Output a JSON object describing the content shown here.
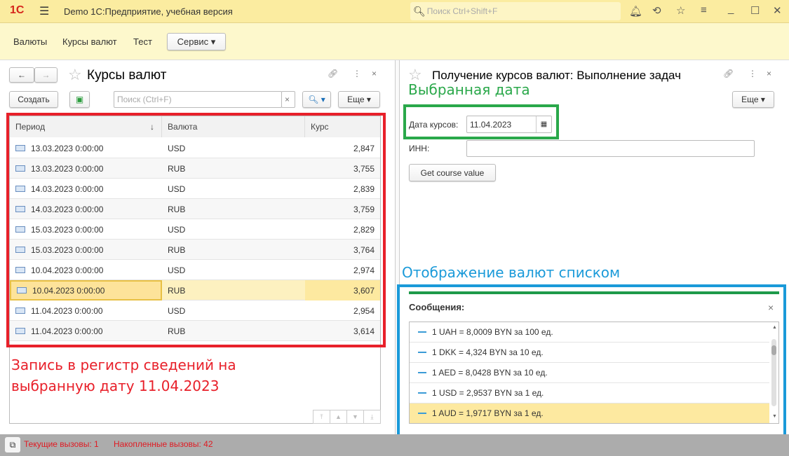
{
  "app": {
    "logo": "1С",
    "title": "Demo 1С:Предприятие, учебная версия",
    "search_placeholder": "Поиск Ctrl+Shift+F"
  },
  "sections": [
    {
      "label": "Валюты"
    },
    {
      "label": "Курсы валют"
    },
    {
      "label": "Тест"
    }
  ],
  "service_label": "Сервис",
  "left": {
    "title": "Курсы валют",
    "create": "Создать",
    "search_placeholder": "Поиск (Ctrl+F)",
    "more": "Еще",
    "columns": [
      "Период",
      "Валюта",
      "Курс"
    ],
    "rows": [
      {
        "period": "13.03.2023 0:00:00",
        "currency": "USD",
        "rate": "2,847"
      },
      {
        "period": "13.03.2023 0:00:00",
        "currency": "RUB",
        "rate": "3,755"
      },
      {
        "period": "14.03.2023 0:00:00",
        "currency": "USD",
        "rate": "2,839"
      },
      {
        "period": "14.03.2023 0:00:00",
        "currency": "RUB",
        "rate": "3,759"
      },
      {
        "period": "15.03.2023 0:00:00",
        "currency": "USD",
        "rate": "2,829"
      },
      {
        "period": "15.03.2023 0:00:00",
        "currency": "RUB",
        "rate": "3,764"
      },
      {
        "period": "10.04.2023 0:00:00",
        "currency": "USD",
        "rate": "2,974"
      },
      {
        "period": "10.04.2023 0:00:00",
        "currency": "RUB",
        "rate": "3,607"
      },
      {
        "period": "11.04.2023 0:00:00",
        "currency": "USD",
        "rate": "2,954"
      },
      {
        "period": "11.04.2023 0:00:00",
        "currency": "RUB",
        "rate": "3,614"
      }
    ],
    "annotation": [
      "Запись в регистр сведений на",
      "выбранную дату 11.04.2023"
    ]
  },
  "right": {
    "title": "Получение курсов валют: Выполнение задач",
    "annotation_date": "Выбранная дата",
    "more": "Еще",
    "date_label": "Дата курсов:",
    "date_value": "11.04.2023",
    "inn_label": "ИНН:",
    "inn_value": "",
    "get_button": "Get course value",
    "annotation_list": "Отображение валют списком",
    "messages_label": "Сообщения:",
    "messages": [
      "1 UAH = 8,0009 BYN за 100 ед.",
      "1 DKK = 4,324 BYN за 10 ед.",
      "1 AED = 8,0428 BYN за 10 ед.",
      "1 USD = 2,9537 BYN за 1 ед.",
      "1 AUD = 1,9717 BYN за 1 ед."
    ]
  },
  "status": {
    "current": "Текущие вызовы: 1",
    "accumulated": "Накопленные вызовы: 42"
  },
  "colors": {
    "annotation_red": "#e8202a",
    "annotation_green": "#2aa84a",
    "annotation_blue": "#1a9ad9",
    "selected_row": "#fde9a0"
  }
}
